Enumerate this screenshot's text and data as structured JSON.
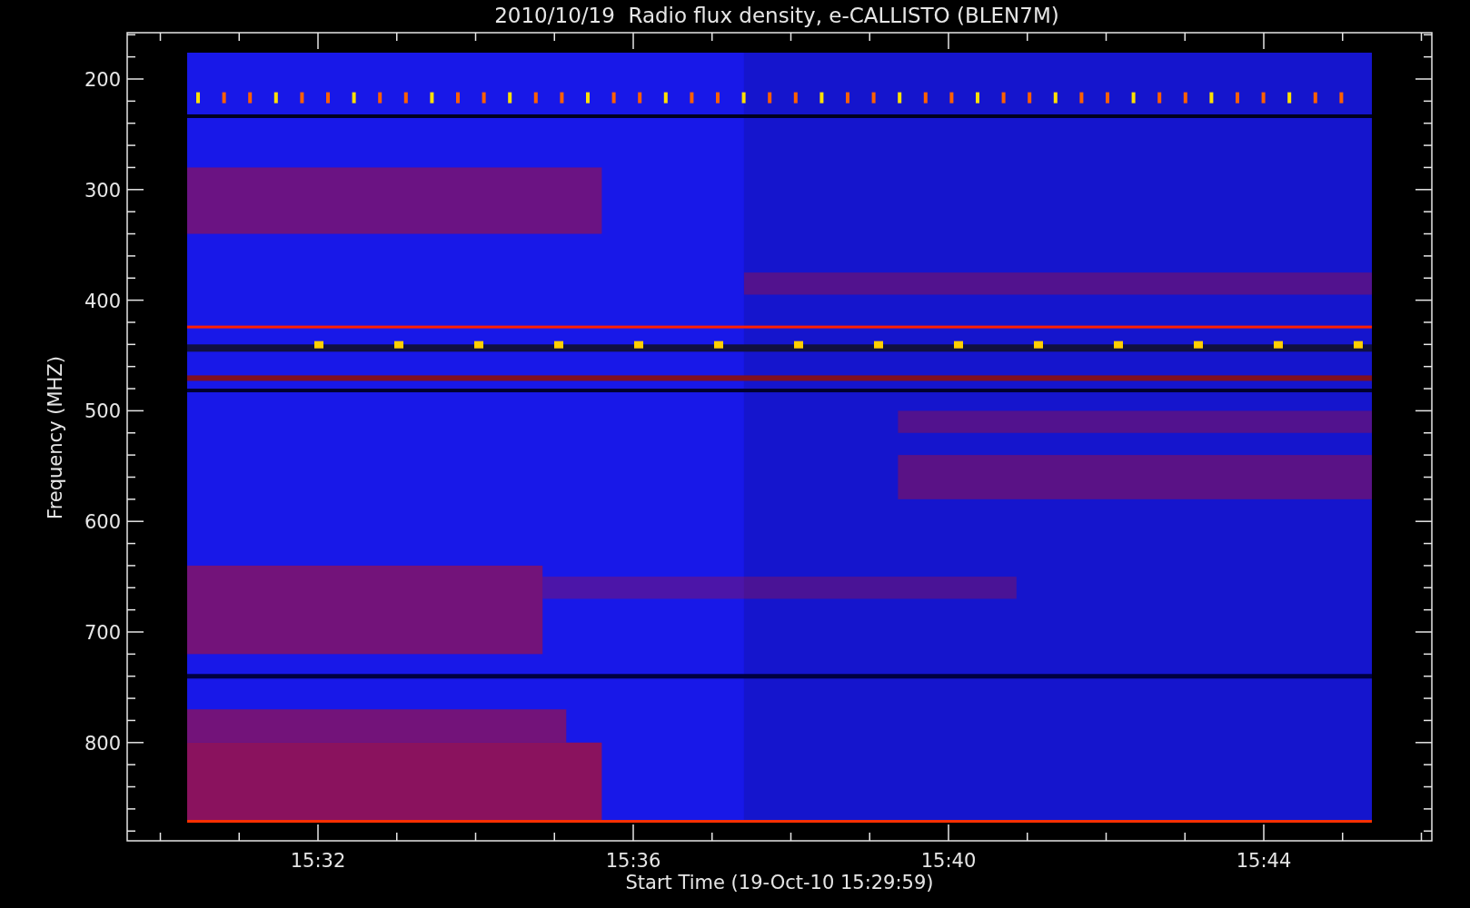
{
  "title": "2010/10/19  Radio flux density, e-CALLISTO (BLEN7M)",
  "y_axis": {
    "label": "Frequency (MHZ)",
    "ticks": [
      "200",
      "300",
      "400",
      "500",
      "600",
      "700",
      "800"
    ]
  },
  "x_axis": {
    "label": "Start Time (19-Oct-10 15:29:59)",
    "ticks": [
      "15:32",
      "15:36",
      "15:40",
      "15:44"
    ]
  }
}
